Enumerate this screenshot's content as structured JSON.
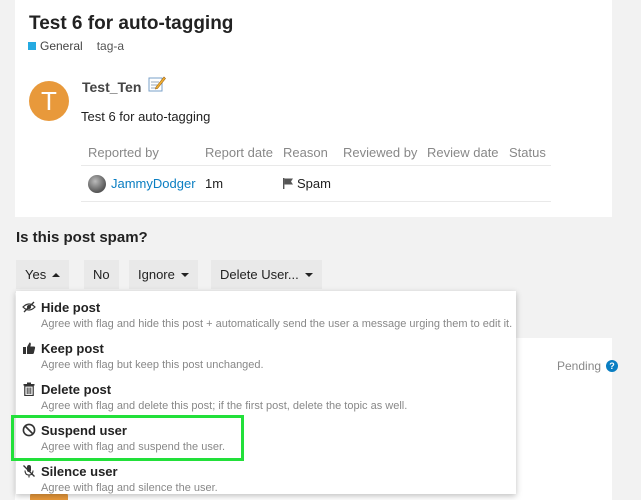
{
  "topic": {
    "title": "Test 6 for auto-tagging",
    "category": "General",
    "tag": "tag-a"
  },
  "post": {
    "avatar_letter": "T",
    "username": "Test_Ten",
    "body": "Test 6 for auto-tagging"
  },
  "flags_table": {
    "headers": [
      "Reported by",
      "Report date",
      "Reason",
      "Reviewed by",
      "Review date",
      "Status"
    ],
    "rows": [
      {
        "reporter": "JammyDodger",
        "date": "1m",
        "reason": "Spam"
      }
    ]
  },
  "question": "Is this post spam?",
  "actions": {
    "yes": "Yes",
    "no": "No",
    "ignore": "Ignore",
    "delete_user": "Delete User..."
  },
  "menu": {
    "items": [
      {
        "icon": "hidden-eye-icon",
        "title": "Hide post",
        "desc": "Agree with flag and hide this post + automatically send the user a message urging them to edit it."
      },
      {
        "icon": "thumbs-up-icon",
        "title": "Keep post",
        "desc": "Agree with flag but keep this post unchanged."
      },
      {
        "icon": "trash-icon",
        "title": "Delete post",
        "desc": "Agree with flag and delete this post; if the first post, delete the topic as well."
      },
      {
        "icon": "ban-icon",
        "title": "Suspend user",
        "desc": "Agree with flag and suspend the user."
      },
      {
        "icon": "microphone-slash-icon",
        "title": "Silence user",
        "desc": "Agree with flag and silence the user."
      }
    ]
  },
  "status": {
    "label": "Pending",
    "help_glyph": "?"
  },
  "colors": {
    "category": "#25aae1",
    "avatar": "#e8993b",
    "link": "#0a7ec2",
    "highlight": "#22e03a"
  }
}
